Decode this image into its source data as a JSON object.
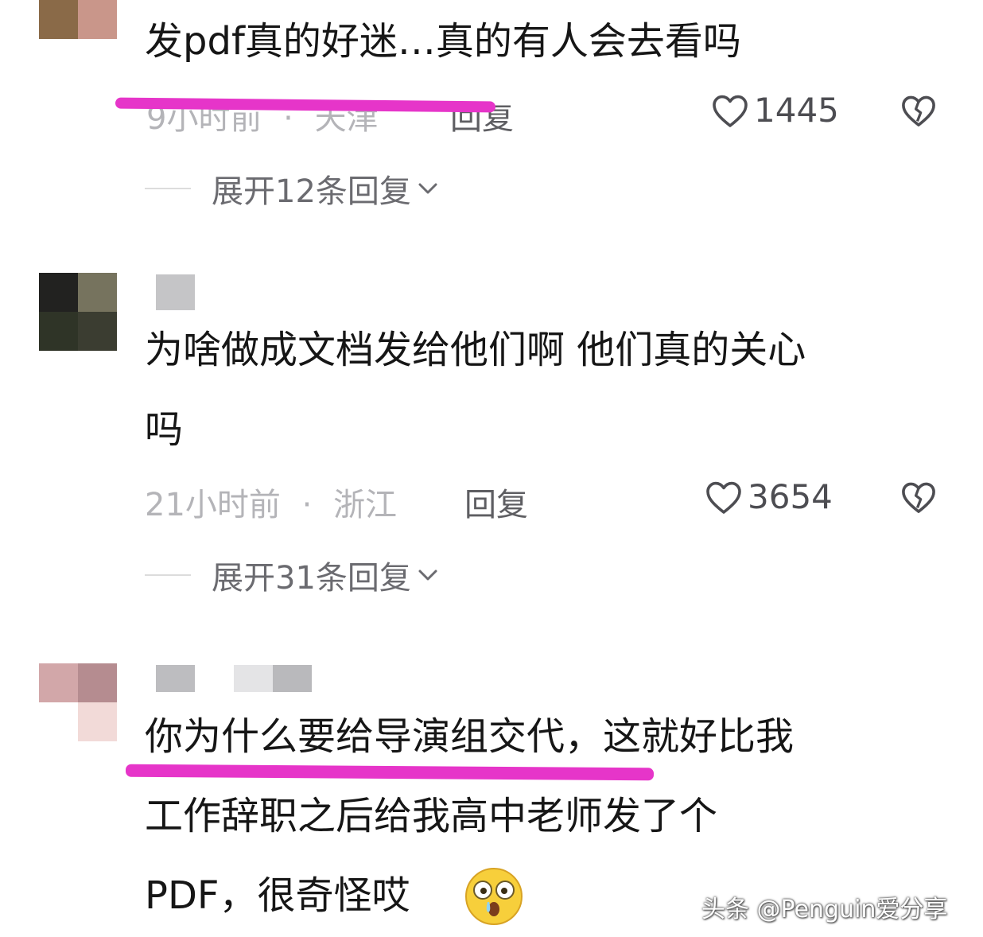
{
  "comments": [
    {
      "text_lines": [
        "发pdf真的好迷…真的有人会去看吗"
      ],
      "time": "9小时前",
      "location": "天津",
      "reply_label": "回复",
      "likes": "1445",
      "expand_label": "展开12条回复"
    },
    {
      "text_lines": [
        "为啥做成文档发给他们啊 他们真的关心",
        "吗"
      ],
      "time": "21小时前",
      "location": "浙江",
      "reply_label": "回复",
      "likes": "3654",
      "expand_label": "展开31条回复"
    },
    {
      "text_lines": [
        "你为什么要给导演组交代，这就好比我",
        "工作辞职之后给我高中老师发了个",
        "PDF，很奇怪哎"
      ]
    }
  ],
  "separator": "·",
  "watermark": "头条 @Penguin爱分享",
  "colors": {
    "highlight": "#e635c9",
    "meta": "#b4b4b8"
  },
  "icons": [
    "heart-outline-icon",
    "broken-heart-icon",
    "chevron-down-icon",
    "surprised-emoji"
  ]
}
